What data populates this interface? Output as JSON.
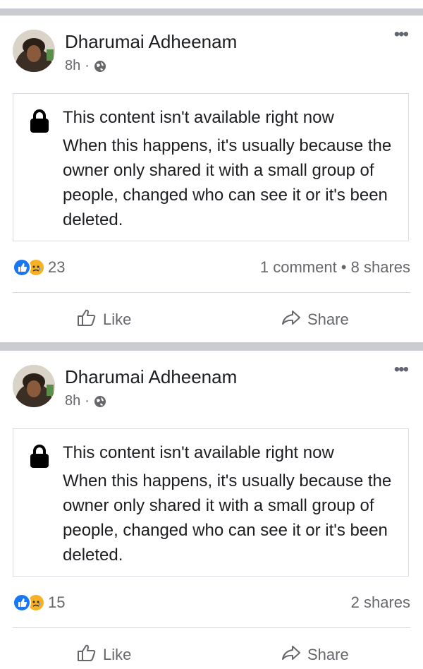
{
  "posts": [
    {
      "author": "Dharumai Adheenam",
      "time": "8h",
      "separator": "·",
      "privacy_icon": "globe-icon",
      "more_label": "•••",
      "notice_title": "This content isn't available right now",
      "notice_body": "When this happens, it's usually because the owner only shared it with a small group of people, changed who can see it or it's been deleted.",
      "reaction_count": "23",
      "engagement": "1 comment • 8 shares",
      "like_label": "Like",
      "share_label": "Share"
    },
    {
      "author": "Dharumai Adheenam",
      "time": "8h",
      "separator": "·",
      "privacy_icon": "globe-icon",
      "more_label": "•••",
      "notice_title": "This content isn't available right now",
      "notice_body": "When this happens, it's usually because the owner only shared it with a small group of people, changed who can see it or it's been deleted.",
      "reaction_count": "15",
      "engagement": "2 shares",
      "like_label": "Like",
      "share_label": "Share"
    }
  ],
  "colors": {
    "divider": "#c9ccd1",
    "like_blue": "#1877f2",
    "sad_yellow": "#f7b125",
    "secondary_text": "#65676b"
  }
}
